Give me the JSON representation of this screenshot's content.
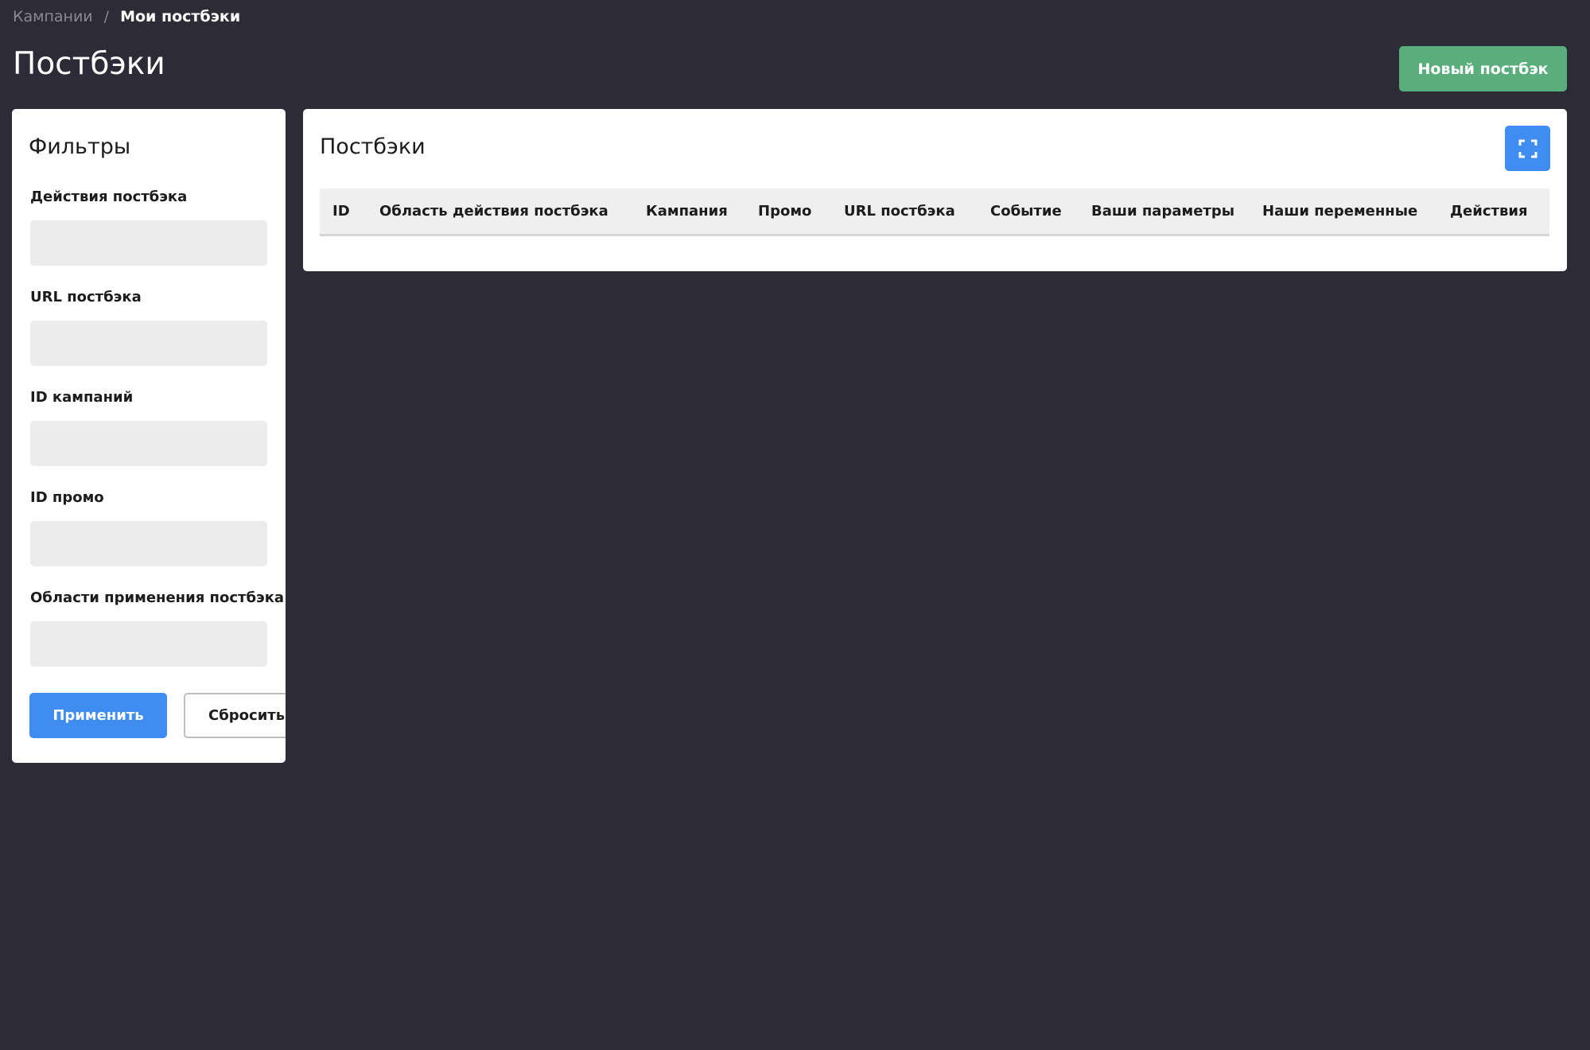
{
  "breadcrumb": {
    "parent": "Кампании",
    "separator": "/",
    "current": "Мои постбэки"
  },
  "header": {
    "title": "Постбэки",
    "new_button": "Новый постбэк"
  },
  "filters": {
    "title": "Фильтры",
    "fields": [
      {
        "label": "Действия постбэка",
        "value": ""
      },
      {
        "label": "URL постбэка",
        "value": ""
      },
      {
        "label": "ID кампаний",
        "value": ""
      },
      {
        "label": "ID промо",
        "value": ""
      },
      {
        "label": "Области применения постбэка",
        "value": ""
      }
    ],
    "apply_button": "Применить",
    "reset_button": "Сбросить"
  },
  "table": {
    "title": "Постбэки",
    "expand_icon": "expand-icon",
    "columns": [
      "ID",
      "Область действия постбэка",
      "Кампания",
      "Промо",
      "URL постбэка",
      "Событие",
      "Ваши параметры",
      "Наши переменные",
      "Действия"
    ],
    "rows": []
  },
  "colors": {
    "background": "#2d2b36",
    "primary": "#3f8df3",
    "success": "#5aae7c"
  }
}
